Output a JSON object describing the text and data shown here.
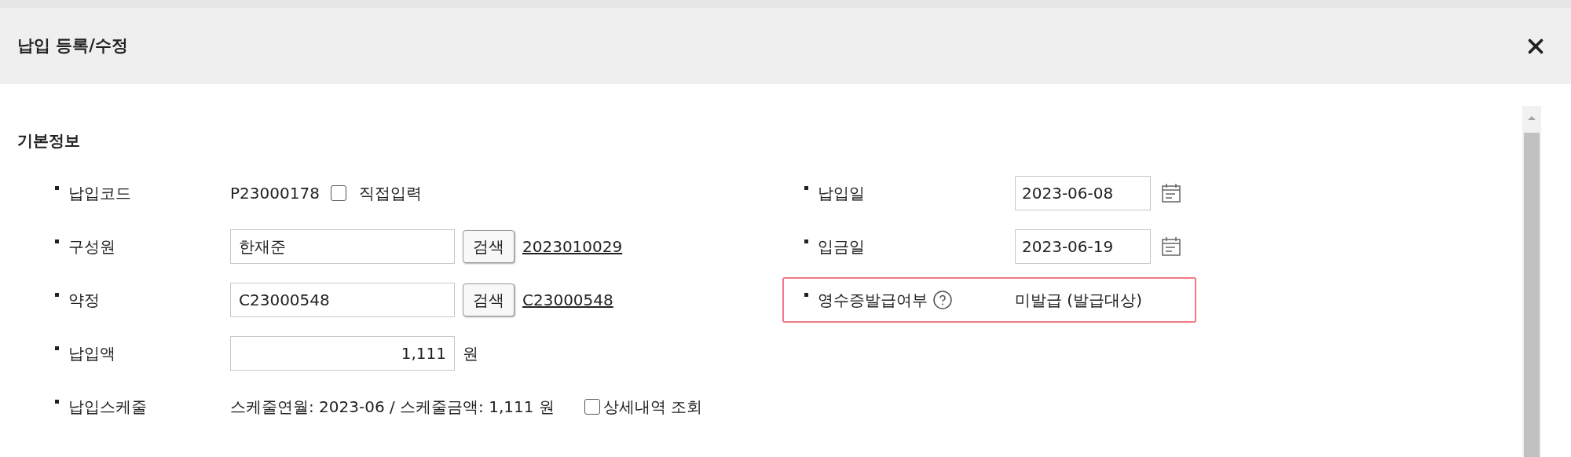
{
  "dialog": {
    "title": "납입 등록/수정"
  },
  "section": {
    "title": "기본정보"
  },
  "left_fields": [
    {
      "kind": "code",
      "label": "납입코드",
      "value": "P23000178",
      "checkbox": {
        "label": "직접입력",
        "checked": false
      }
    },
    {
      "kind": "search",
      "label": "구성원",
      "value": "한재준",
      "button": "검색",
      "link": "2023010029"
    },
    {
      "kind": "search",
      "label": "약정",
      "value": "C23000548",
      "button": "검색",
      "link": "C23000548"
    },
    {
      "kind": "amount",
      "label": "납입액",
      "value": "1,111",
      "unit": "원"
    },
    {
      "kind": "schedule",
      "label": "납입스케줄",
      "text": "스케줄연월: 2023-06 / 스케줄금액: 1,111 원",
      "checkbox": {
        "label": "상세내역 조회",
        "checked": false
      }
    }
  ],
  "right_fields": [
    {
      "kind": "date",
      "label": "납입일",
      "value": "2023-06-08",
      "highlighted": false
    },
    {
      "kind": "date",
      "label": "입금일",
      "value": "2023-06-19",
      "highlighted": false
    },
    {
      "kind": "status",
      "label": "영수증발급여부",
      "value": "미발급 (발급대상)",
      "highlighted": true
    }
  ]
}
